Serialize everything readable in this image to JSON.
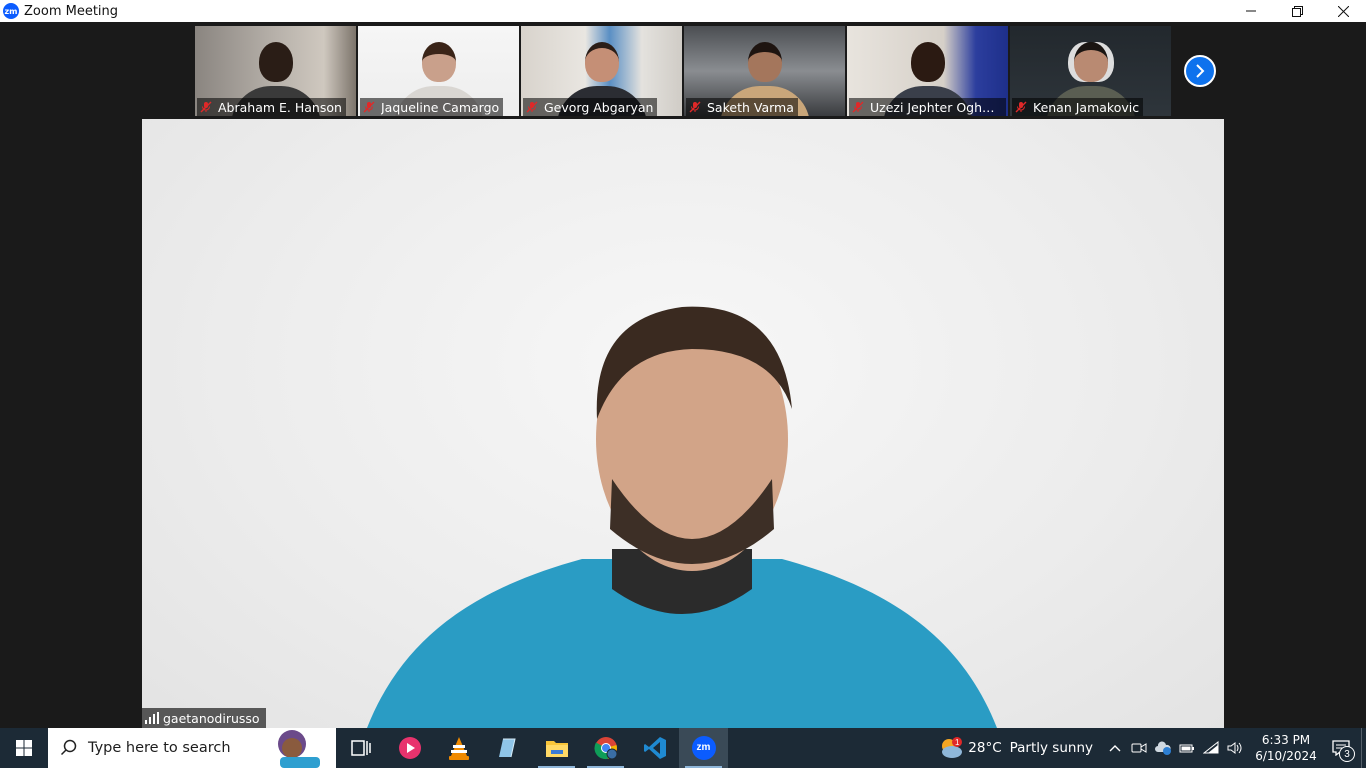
{
  "window": {
    "title": "Zoom Meeting",
    "app_icon_text": "zm"
  },
  "participants": [
    {
      "name": "Abraham E. Hanson",
      "muted": true
    },
    {
      "name": "Jaqueline Camargo",
      "muted": true
    },
    {
      "name": "Gevorg Abgaryan",
      "muted": true
    },
    {
      "name": "Saketh Varma",
      "muted": true
    },
    {
      "name": "Uzezi Jephter Ogheneka...",
      "muted": true
    },
    {
      "name": "Kenan Jamakovic",
      "muted": true
    }
  ],
  "active_speaker": {
    "name": "gaetanodirusso"
  },
  "taskbar": {
    "search_placeholder": "Type here to search",
    "weather_temp": "28°C",
    "weather_condition": "Partly sunny",
    "weather_alert_count": "1",
    "time": "6:33 PM",
    "date": "6/10/2024",
    "notification_count": "3",
    "apps": [
      "task-view",
      "media-player",
      "vlc",
      "notepad",
      "file-explorer",
      "chrome",
      "vscode",
      "zoom"
    ],
    "zoom_icon_text": "zm"
  },
  "colors": {
    "zoom_blue": "#0b5cff",
    "taskbar_bg": "#1c2a36",
    "mute_red": "#e02828"
  }
}
